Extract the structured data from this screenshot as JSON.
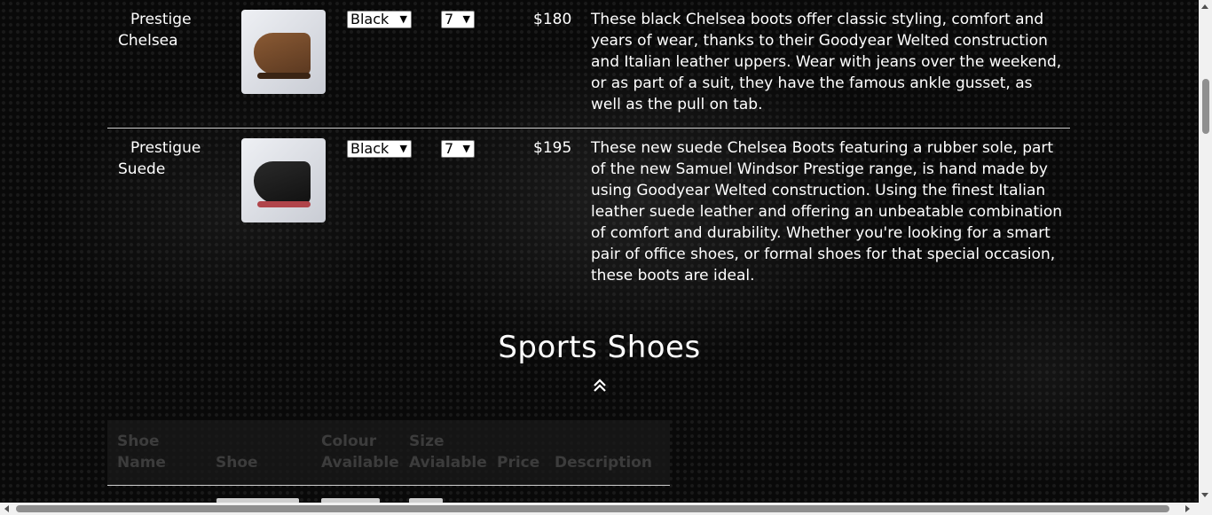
{
  "products": [
    {
      "name": "Prestige Chelsea",
      "colour": "Black",
      "size": "7",
      "price": "$180",
      "description": "These black Chelsea boots offer classic styling, comfort and years of wear, thanks to their Goodyear Welted construction and Italian leather uppers. Wear with jeans over the weekend, or as part of a suit, they have the famous ankle gusset, as well as the pull on tab."
    },
    {
      "name": "Prestigue Suede",
      "colour": "Black",
      "size": "7",
      "price": "$195",
      "description": "These new suede Chelsea Boots featuring a rubber sole, part of the new Samuel Windsor Prestige range, is hand made by using Goodyear Welted construction. Using the finest Italian leather suede leather and offering an unbeatable combination of comfort and durability. Whether you're looking for a smart pair of office shoes, or formal shoes for that special occasion, these boots are ideal."
    }
  ],
  "sports_section": {
    "title": "Sports Shoes",
    "back_to_top_icon": "double-chevron-up-icon",
    "columns": [
      "Shoe Name",
      "Shoe",
      "Colour Available",
      "Size Avialable",
      "Price",
      "Description"
    ]
  },
  "icons": {
    "dropdown": "chevron-down-icon"
  }
}
